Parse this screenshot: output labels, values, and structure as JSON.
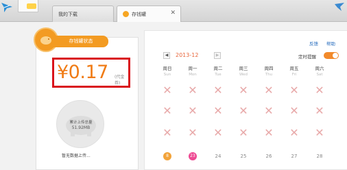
{
  "tabs": [
    {
      "label": "我的下载"
    },
    {
      "label": "存钱罐"
    }
  ],
  "left": {
    "status_label": "存钱罐状态",
    "amount": "¥0.17",
    "amount_unit": "(代金券)",
    "upload_label": "累计上传总量",
    "upload_value": "51.92MB",
    "no_data": "暂无数据上传..."
  },
  "right": {
    "feedback": "反馈",
    "help": "帮助",
    "month": "2013-12",
    "reminder": "定时提醒",
    "weekdays": [
      {
        "cn": "周日",
        "en": "Sun"
      },
      {
        "cn": "周一",
        "en": "Mon"
      },
      {
        "cn": "周二",
        "en": "Tue"
      },
      {
        "cn": "周三",
        "en": "Wed"
      },
      {
        "cn": "周四",
        "en": "Thu"
      },
      {
        "cn": "周五",
        "en": "Fri"
      },
      {
        "cn": "周六",
        "en": "Sat"
      }
    ],
    "last_row": [
      "8",
      "23",
      "24",
      "25",
      "26",
      "27",
      "28"
    ]
  }
}
